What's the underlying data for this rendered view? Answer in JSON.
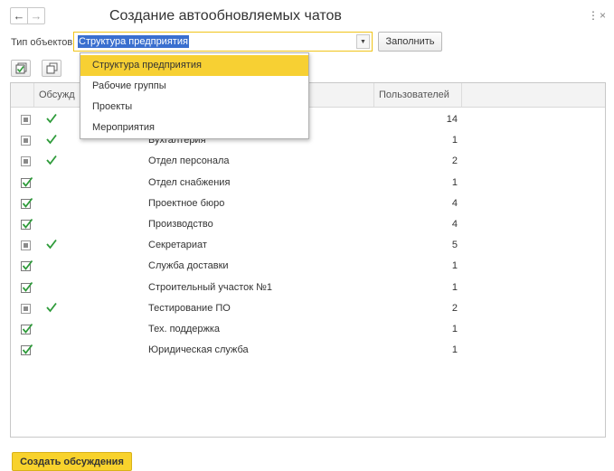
{
  "window": {
    "title": "Создание автообновляемых чатов",
    "more_icon": "⋮",
    "close_icon": "×"
  },
  "filter": {
    "type_label": "Тип объектов:",
    "type_value": "Структура предприятия",
    "fill_button": "Заполнить"
  },
  "table": {
    "columns": [
      "Обсужд",
      "Пользователей"
    ],
    "rows": [
      {
        "check": "partial",
        "discussion": true,
        "name": "",
        "users": "14"
      },
      {
        "check": "partial",
        "discussion": true,
        "name": "Бухгалтерия",
        "users": "1"
      },
      {
        "check": "partial",
        "discussion": true,
        "name": "Отдел персонала",
        "users": "2"
      },
      {
        "check": "checked",
        "discussion": false,
        "name": "Отдел снабжения",
        "users": "1"
      },
      {
        "check": "checked",
        "discussion": false,
        "name": "Проектное бюро",
        "users": "4"
      },
      {
        "check": "checked",
        "discussion": false,
        "name": "Производство",
        "users": "4"
      },
      {
        "check": "partial",
        "discussion": true,
        "name": "Секретариат",
        "users": "5"
      },
      {
        "check": "checked",
        "discussion": false,
        "name": "Служба доставки",
        "users": "1"
      },
      {
        "check": "checked",
        "discussion": false,
        "name": "Строительный участок №1",
        "users": "1"
      },
      {
        "check": "partial",
        "discussion": true,
        "name": "Тестирование ПО",
        "users": "2"
      },
      {
        "check": "checked",
        "discussion": false,
        "name": "Тех. поддержка",
        "users": "1"
      },
      {
        "check": "checked",
        "discussion": false,
        "name": "Юридическая служба",
        "users": "1"
      }
    ]
  },
  "dropdown": {
    "items": [
      "Структура предприятия",
      "Рабочие группы",
      "Проекты",
      "Мероприятия"
    ],
    "selected_index": 0
  },
  "footer": {
    "create_button": "Создать обсуждения"
  },
  "colors": {
    "accent": "#f8d22c",
    "check_green": "#2e9b3a",
    "selection_blue": "#3a6fcf"
  }
}
